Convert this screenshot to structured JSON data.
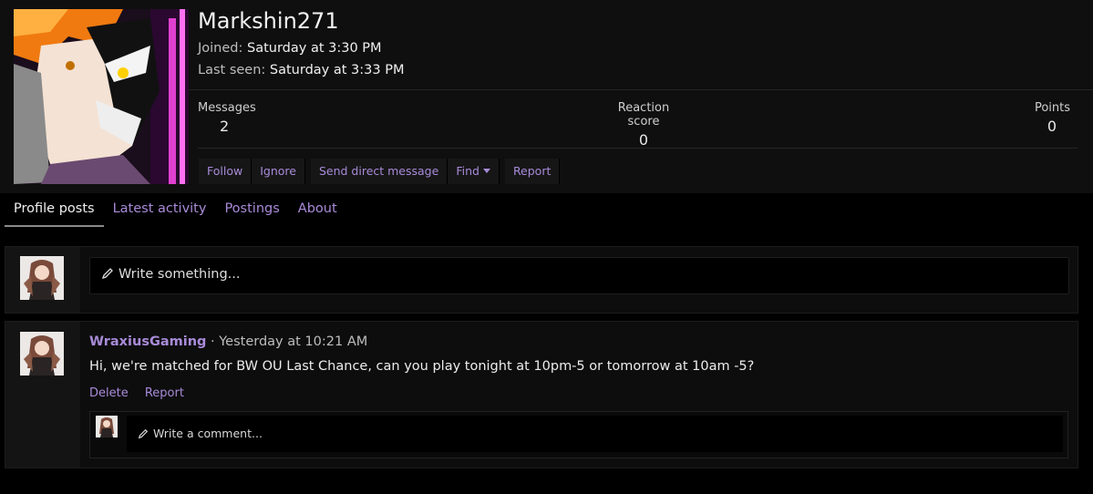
{
  "profile": {
    "username": "Markshin271",
    "joined_label": "Joined:",
    "joined_value": "Saturday at 3:30 PM",
    "last_seen_label": "Last seen:",
    "last_seen_value": "Saturday at 3:33 PM",
    "stats": {
      "messages_label": "Messages",
      "messages_value": "2",
      "reaction_label": "Reaction score",
      "reaction_value": "0",
      "points_label": "Points",
      "points_value": "0"
    },
    "actions": {
      "follow": "Follow",
      "ignore": "Ignore",
      "send_dm": "Send direct message",
      "find": "Find",
      "report": "Report"
    }
  },
  "tabs": [
    {
      "label": "Profile posts",
      "active": true
    },
    {
      "label": "Latest activity",
      "active": false
    },
    {
      "label": "Postings",
      "active": false
    },
    {
      "label": "About",
      "active": false
    }
  ],
  "compose": {
    "placeholder": "Write something..."
  },
  "post": {
    "author": "WraxiusGaming",
    "separator": "·",
    "time": "Yesterday at 10:21 AM",
    "body": "Hi, we're matched for BW OU Last Chance, can you play tonight at 10pm-5 or tomorrow at 10am -5?",
    "actions": {
      "delete": "Delete",
      "report": "Report"
    },
    "comment_placeholder": "Write a comment..."
  },
  "icons": {
    "compose": "pencil-icon",
    "comment": "pencil-icon",
    "find_menu": "caret-down-icon"
  },
  "colors": {
    "accent_link": "#a98bd9",
    "page_background": "#000000",
    "panel_background": "#0f0f0f"
  }
}
